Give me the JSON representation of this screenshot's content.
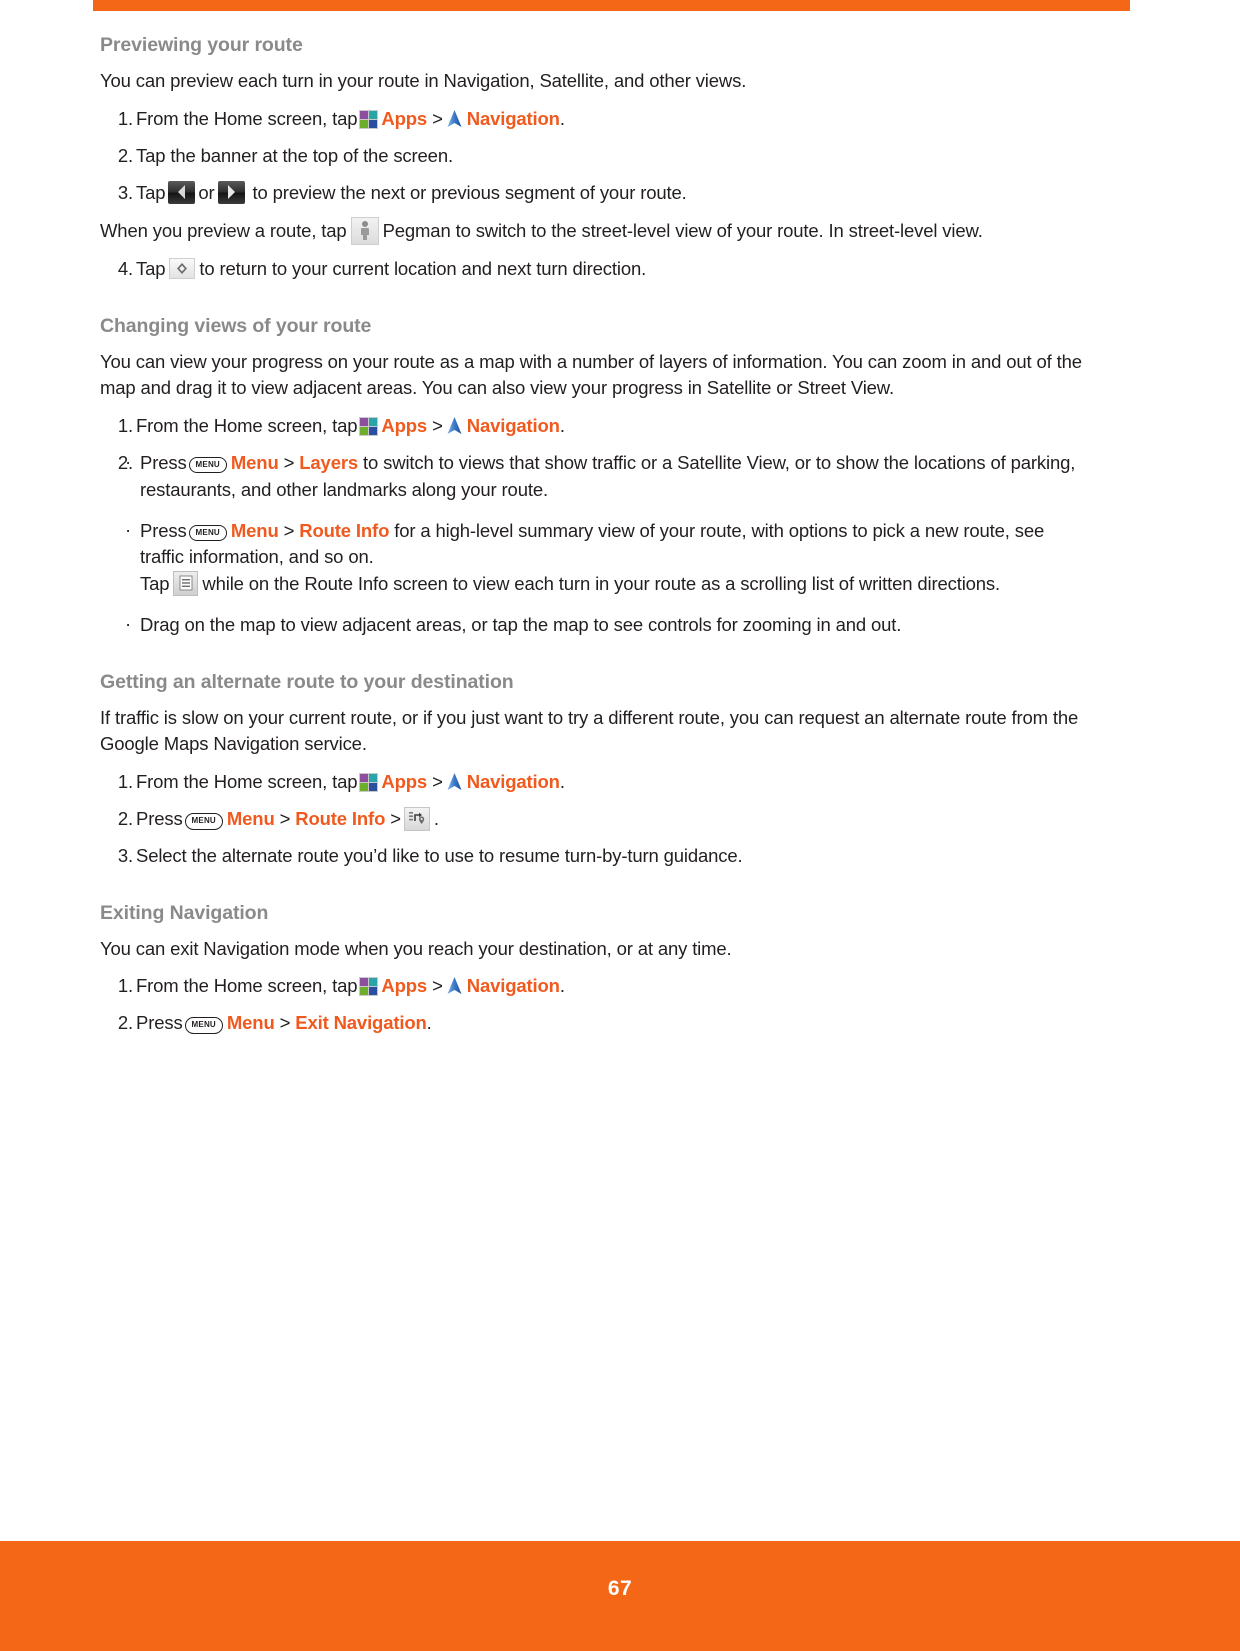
{
  "page": {
    "number": "67",
    "accent_color": "#f36717",
    "heading_color": "#8a8a8a",
    "link_color": "#f05a1e"
  },
  "icons": {
    "apps": "apps-grid-icon",
    "navigation": "navigation-arrow-icon",
    "menu_key": "MENU",
    "previous": "previous-arrow-button-icon",
    "next": "next-arrow-button-icon",
    "pegman": "pegman-street-view-icon",
    "recenter": "recenter-compass-icon",
    "directions_list": "directions-list-icon",
    "alternate_route": "alternate-route-map-icon"
  },
  "sections": [
    {
      "heading": "Previewing your route",
      "intro": "You can preview each turn in your route in Navigation, Satellite, and other views.",
      "step1": {
        "num": "1.",
        "lead": "From the Home screen, tap",
        "apps": "Apps",
        "gt": ">",
        "navigation": "Navigation",
        "period": "."
      },
      "step2": {
        "num": "2.",
        "text": "Tap the banner at the top of the screen."
      },
      "step3": {
        "num": "3.",
        "lead": "Tap",
        "or": "or",
        "tail": "to preview the next or previous segment of your route."
      },
      "note": {
        "lead": "When you preview a route, tap",
        "tail": "Pegman to switch to the street-level view of your route. In street-level view."
      },
      "step4": {
        "num": "4.",
        "lead": "Tap",
        "tail": "to return to your current location and next turn direction."
      }
    },
    {
      "heading": "Changing views of your route",
      "intro": "You can view your progress on your route as a map with a number of layers of information. You can zoom in and out of the map and drag it to view adjacent areas. You can also view your progress in Satellite or Street View.",
      "step1": {
        "num": "1.",
        "lead": "From the Home screen, tap",
        "apps": "Apps",
        "gt": ">",
        "navigation": "Navigation",
        "period": "."
      },
      "step2": {
        "num": "2.",
        "text": ""
      },
      "bullets": [
        {
          "dot": "·",
          "lead": "Press",
          "menu": "Menu",
          "gt": ">",
          "target": "Layers",
          "tail": "to switch to views that show traffic or a Satellite View, or to show the locations of parking, restaurants, and other landmarks along your route."
        },
        {
          "dot": "·",
          "lead": "Press",
          "menu": "Menu",
          "gt": ">",
          "target": "Route Info",
          "tail": "for a high-level summary view of your route, with options to pick a new route, see traffic information, and so on.",
          "sub_lead": "Tap",
          "sub_tail": "while on the Route Info screen to view each turn in your route as a scrolling list of written directions."
        },
        {
          "dot": "·",
          "text": "Drag on the map to view adjacent areas, or tap the map to see controls for zooming in and out."
        }
      ]
    },
    {
      "heading": "Getting an alternate route to your destination",
      "intro": "If traffic is slow on your current route, or if you just want to try a different route, you can request an alternate route from the Google Maps Navigation service.",
      "step1": {
        "num": "1.",
        "lead": "From the Home screen, tap",
        "apps": "Apps",
        "gt": ">",
        "navigation": "Navigation",
        "period": "."
      },
      "step2": {
        "num": "2.",
        "lead": "Press",
        "menu": "Menu",
        "gt1": ">",
        "target": "Route Info",
        "gt2": ">",
        "period": "."
      },
      "step3": {
        "num": "3.",
        "text": "Select the alternate route you’d like to use to resume turn-by-turn guidance."
      }
    },
    {
      "heading": "Exiting Navigation",
      "intro": "You can exit Navigation mode when you reach your destination, or at any time.",
      "step1": {
        "num": "1.",
        "lead": "From the Home screen, tap",
        "apps": "Apps",
        "gt": ">",
        "navigation": "Navigation",
        "period": "."
      },
      "step2": {
        "num": "2.",
        "lead": "Press",
        "menu": "Menu",
        "gt": ">",
        "target": "Exit Navigation",
        "period": "."
      }
    }
  ]
}
